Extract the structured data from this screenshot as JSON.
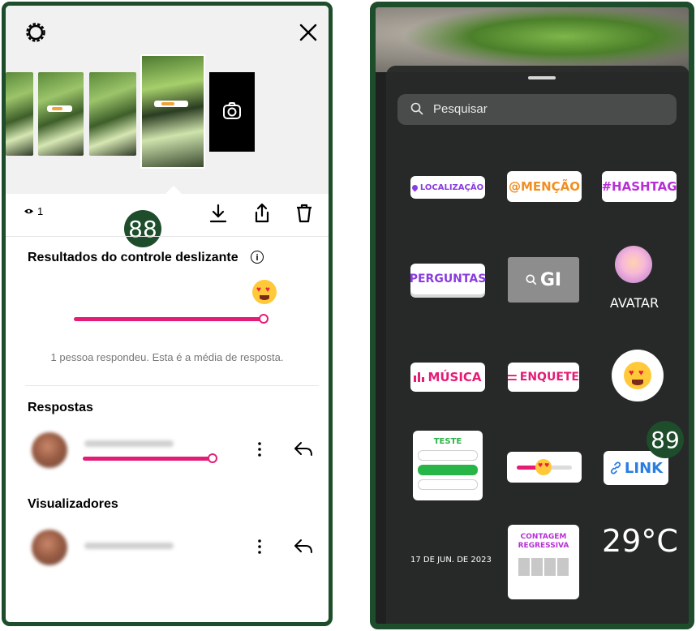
{
  "left_panel": {
    "views_count": "1",
    "badge": "88",
    "slider_results": {
      "title": "Resultados do controle deslizante",
      "info_icon": "info-icon",
      "average_fraction": 1.0,
      "caption": "1 pessoa respondeu. Esta é a média de resposta."
    },
    "responses": {
      "title": "Respostas",
      "items": [
        {
          "slider_fraction": 1.0
        }
      ]
    },
    "viewers": {
      "title": "Visualizadores"
    },
    "icons": [
      "gear-icon",
      "close-icon",
      "camera-icon",
      "eye-icon",
      "download-icon",
      "share-icon",
      "trash-icon",
      "more-icon",
      "reply-icon"
    ]
  },
  "right_panel": {
    "badge": "89",
    "search_placeholder": "Pesquisar",
    "stickers": {
      "location": "LOCALIZAÇÃO",
      "mention": "@MENÇÃO",
      "hashtag": "#HASHTAG",
      "questions": "PERGUNTAS",
      "gif": "GI",
      "avatar": "AVATAR",
      "music": "MÚSICA",
      "poll": "ENQUETE",
      "quiz": "TESTE",
      "link": "LINK",
      "date": "17 DE JUN. DE 2023",
      "countdown": "CONTAGEM REGRESSIVA",
      "temperature": "29°C"
    },
    "colors": {
      "accent_pink": "#e41c75",
      "purple": "#8a3be0",
      "orange": "#f08f22",
      "magenta": "#b72fd6",
      "green": "#28b548",
      "blue": "#2a7de1",
      "frame_green": "#1d4d2b"
    }
  }
}
